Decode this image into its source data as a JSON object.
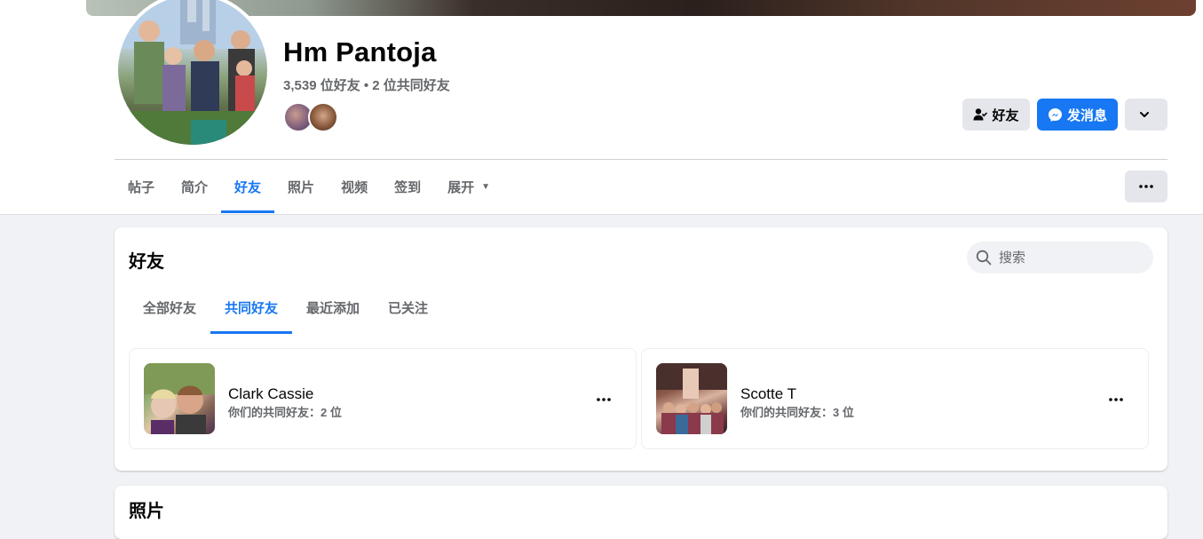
{
  "profile": {
    "name": "Hm Pantoja",
    "subline": "3,539 位好友 • 2 位共同好友"
  },
  "actions": {
    "friend_label": "好友",
    "message_label": "发消息"
  },
  "nav_tabs": [
    {
      "label": "帖子"
    },
    {
      "label": "简介"
    },
    {
      "label": "好友"
    },
    {
      "label": "照片"
    },
    {
      "label": "视频"
    },
    {
      "label": "签到"
    },
    {
      "label": "展开"
    }
  ],
  "friends_card": {
    "title": "好友",
    "search_placeholder": "搜索",
    "subtabs": [
      {
        "label": "全部好友"
      },
      {
        "label": "共同好友"
      },
      {
        "label": "最近添加"
      },
      {
        "label": "已关注"
      }
    ],
    "friends": [
      {
        "name": "Clark Cassie",
        "mutual": "你们的共同好友：2 位"
      },
      {
        "name": "Scotte T",
        "mutual": "你们的共同好友：3 位"
      }
    ]
  },
  "photos_card": {
    "title": "照片"
  },
  "colors": {
    "accent": "#1877f2",
    "secondary_button": "#e4e6eb",
    "page_bg": "#f0f2f5",
    "muted_text": "#65676b"
  },
  "icons": {
    "friend_button": "person-check-icon",
    "message_button": "messenger-icon",
    "dropdown": "chevron-down-icon",
    "more": "ellipsis-icon",
    "search": "search-icon",
    "expand": "caret-down-icon"
  }
}
